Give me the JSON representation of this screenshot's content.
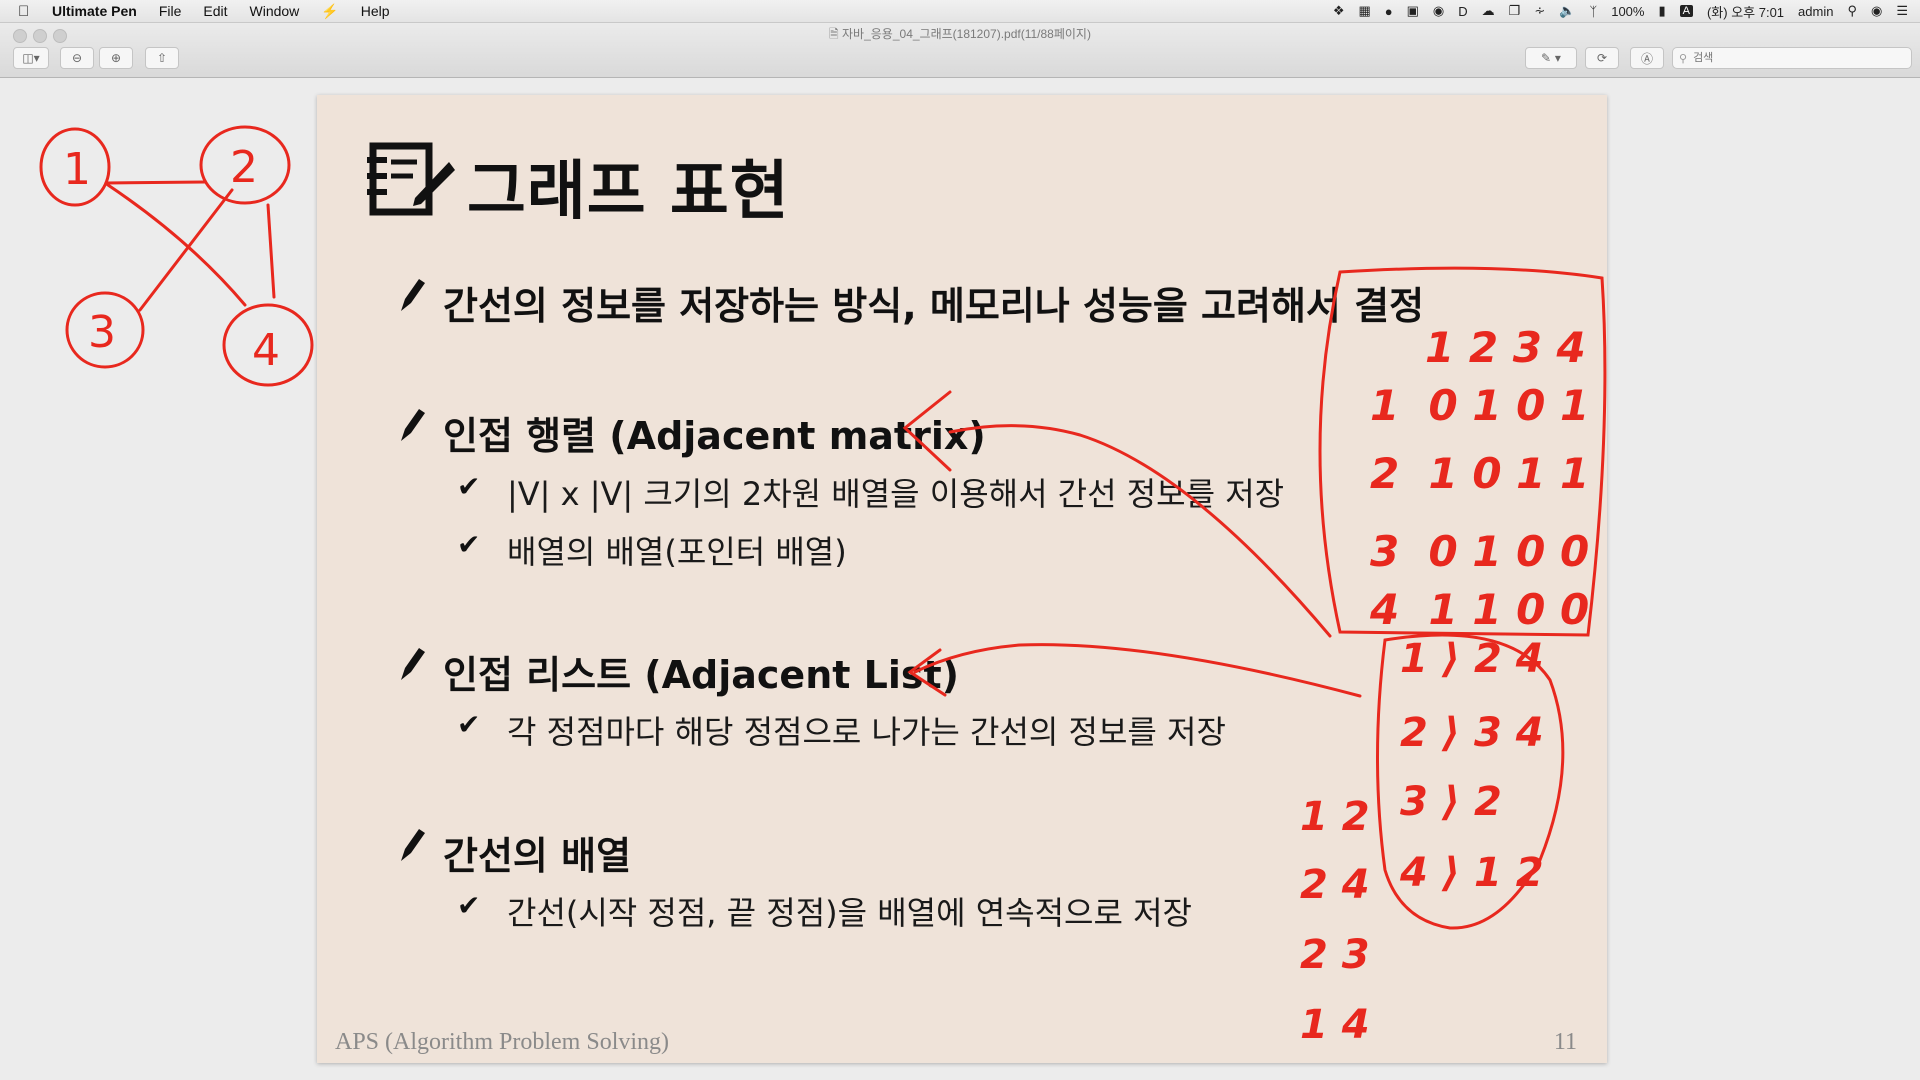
{
  "menubar": {
    "apple_icon": "apple-icon",
    "app_name": "Ultimate Pen",
    "menus": [
      "File",
      "Edit",
      "Window",
      "Help"
    ],
    "battery": "100%",
    "input_method": "A",
    "clock": "(화) 오후 7:01",
    "user": "admin"
  },
  "window": {
    "document_title": "자바_응용_04_그래프(181207).pdf(11/88페이지)",
    "search_placeholder": "검색"
  },
  "slide": {
    "title": "그래프 표현",
    "bullets": [
      {
        "text": "간선의 정보를 저장하는 방식, 메모리나 성능을 고려해서 결정",
        "subs": []
      },
      {
        "text": "인접 행렬 (Adjacent matrix)",
        "subs": [
          "|V| x |V| 크기의 2차원 배열을 이용해서 간선 정보를 저장",
          "배열의 배열(포인터 배열)"
        ]
      },
      {
        "text": "인접 리스트 (Adjacent List)",
        "subs": [
          "각 정점마다 해당 정점으로 나가는 간선의 정보를 저장"
        ]
      },
      {
        "text": "간선의 배열",
        "subs": [
          "간선(시작 정점, 끝 정점)을 배열에 연속적으로 저장"
        ]
      }
    ],
    "footer_left": "APS (Algorithm Problem Solving)",
    "page_number": "11"
  },
  "annotations": {
    "ink_color": "#e8281e",
    "graph_nodes": [
      "1",
      "2",
      "3",
      "4"
    ],
    "matrix_header": "1 2 3 4",
    "matrix_rows": [
      "1  0 1 0 1",
      "2  1 0 1 1",
      "3  0 1 0 0",
      "4  1 1 0 0"
    ],
    "adjacency_list": [
      "1 ⟩ 2 4",
      "2 ⟩ 3 4",
      "3 ⟩ 2",
      "4 ⟩ 1 2"
    ],
    "edge_list": [
      "1 2",
      "2 4",
      "2 3",
      "1 4"
    ]
  },
  "colors": {
    "slide_background": "#efe3d9",
    "app_background": "#ececec",
    "annotation_red": "#e8281e"
  }
}
